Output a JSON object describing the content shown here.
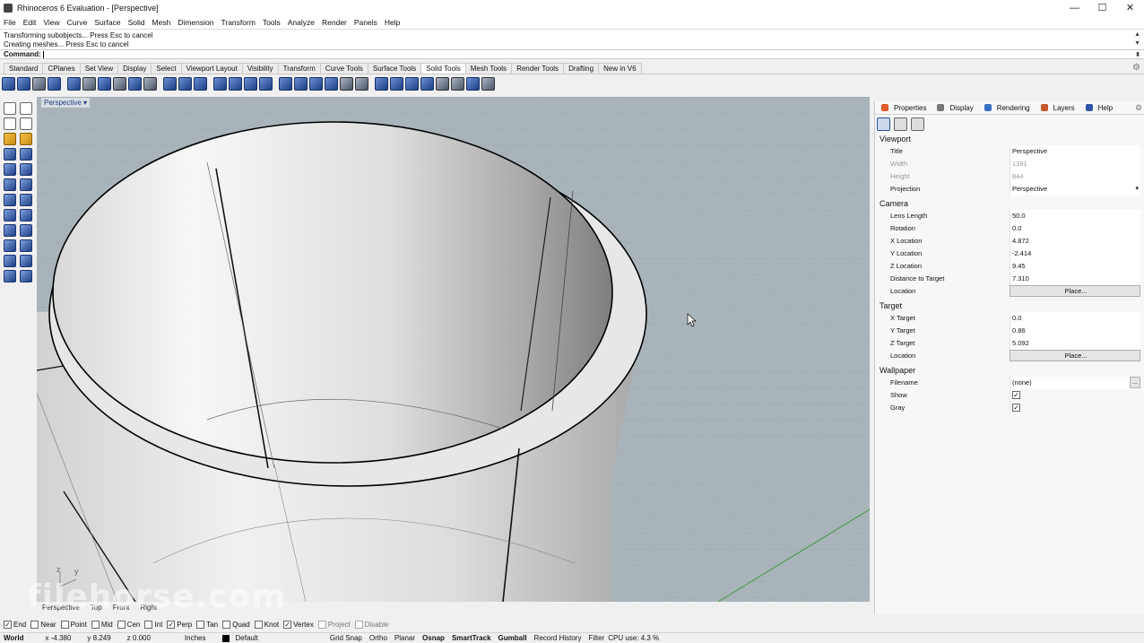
{
  "window": {
    "title": "Rhinoceros 6 Evaluation - [Perspective]",
    "controls": [
      "—",
      "☐",
      "✕"
    ]
  },
  "menu": [
    "File",
    "Edit",
    "View",
    "Curve",
    "Surface",
    "Solid",
    "Mesh",
    "Dimension",
    "Transform",
    "Tools",
    "Analyze",
    "Render",
    "Panels",
    "Help"
  ],
  "command": {
    "history": [
      "Transforming subobjects... Press Esc to cancel",
      "Creating meshes... Press Esc to cancel"
    ],
    "prompt_label": "Command:",
    "value": ""
  },
  "toolbar_tabs": {
    "items": [
      "Standard",
      "CPlanes",
      "Set View",
      "Display",
      "Select",
      "Viewport Layout",
      "Visibility",
      "Transform",
      "Curve Tools",
      "Surface Tools",
      "Solid Tools",
      "Mesh Tools",
      "Render Tools",
      "Drafting",
      "New in V6"
    ],
    "active": "Solid Tools"
  },
  "viewport": {
    "name": "Perspective",
    "tabs": [
      "Perspective",
      "Top",
      "Front",
      "Right"
    ],
    "axis_labels": {
      "z": "z",
      "y": "y"
    }
  },
  "panel": {
    "tabs": [
      "Properties",
      "Display",
      "Rendering",
      "Layers",
      "Help"
    ],
    "sections": {
      "viewport": "Viewport",
      "camera": "Camera",
      "target": "Target",
      "wallpaper": "Wallpaper"
    },
    "viewport": {
      "title_label": "Title",
      "title_value": "Perspective",
      "width_label": "Width",
      "width_value": "1391",
      "height_label": "Height",
      "height_value": "844",
      "projection_label": "Projection",
      "projection_value": "Perspective"
    },
    "camera": {
      "lens_label": "Lens Length",
      "lens_value": "50.0",
      "rotation_label": "Rotation",
      "rotation_value": "0.0",
      "xloc_label": "X Location",
      "xloc_value": "4.872",
      "yloc_label": "Y Location",
      "yloc_value": "-2.414",
      "zloc_label": "Z Location",
      "zloc_value": "9.45",
      "dist_label": "Distance to Target",
      "dist_value": "7.310",
      "location_label": "Location",
      "place_label": "Place..."
    },
    "target": {
      "x_label": "X Target",
      "x_value": "0.0",
      "y_label": "Y Target",
      "y_value": "0.86",
      "z_label": "Z Target",
      "z_value": "5.092",
      "location_label": "Location",
      "place_label": "Place..."
    },
    "wallpaper": {
      "filename_label": "Filename",
      "filename_value": "(none)",
      "browse": "...",
      "show_label": "Show",
      "show_checked": "✓",
      "gray_label": "Gray",
      "gray_checked": "✓"
    }
  },
  "osnap": [
    {
      "label": "End",
      "check": "✓"
    },
    {
      "label": "Near",
      "check": ""
    },
    {
      "label": "Point",
      "check": ""
    },
    {
      "label": "Mid",
      "check": ""
    },
    {
      "label": "Cen",
      "check": ""
    },
    {
      "label": "Int",
      "check": ""
    },
    {
      "label": "Perp",
      "check": "✓"
    },
    {
      "label": "Tan",
      "check": ""
    },
    {
      "label": "Quad",
      "check": ""
    },
    {
      "label": "Knot",
      "check": ""
    },
    {
      "label": "Vertex",
      "check": "✓"
    },
    {
      "label": "Project",
      "check": ""
    },
    {
      "label": "Disable",
      "check": ""
    }
  ],
  "status": {
    "cplane": "World",
    "x": "x -4.380",
    "y": "y 8.249",
    "z": "z 0.000",
    "units": "Inches",
    "layer": "Default",
    "grid_snap": "Grid Snap",
    "ortho": "Ortho",
    "planar": "Planar",
    "osnap": "Osnap",
    "smarttrack": "SmartTrack",
    "gumball": "Gumball",
    "record_history": "Record History",
    "filter": "Filter",
    "cpu": "CPU use: 4.3 %"
  },
  "watermark": "filehorse.com"
}
